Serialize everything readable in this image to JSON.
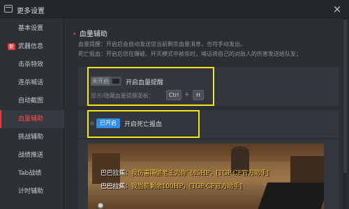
{
  "window": {
    "title": "更多设置",
    "close_icon": "×"
  },
  "sidebar": {
    "items": [
      {
        "label": "基本设置"
      },
      {
        "label": "武器信息",
        "badge": "新"
      },
      {
        "label": "击杀特效"
      },
      {
        "label": "连杀喊话"
      },
      {
        "label": "自动截图"
      },
      {
        "label": "血量辅助",
        "active": true
      },
      {
        "label": "挑战辅助"
      },
      {
        "label": "战绩推送"
      },
      {
        "label": "Tab战绩"
      },
      {
        "label": "计时辅助"
      }
    ]
  },
  "main": {
    "section_title": "血量辅助",
    "desc_hp": "血量提醒：开启后会自动发送您当前剩余血量消息，也可手动发出。",
    "desc_death": "死亡报血：开启后您在爆破、歼灭模式中被杀时，喊话将自己的对敌人的伤害发送给队友；",
    "hp_toggle": {
      "state_label": "未开启",
      "label": "开启血量提醒"
    },
    "hotkey": {
      "label": "显示/隐藏血量提醒面板：",
      "key1": "Ctrl",
      "plus": "+",
      "key2": "H"
    },
    "death_toggle": {
      "state_label": "已开启",
      "label": "开启死亡报血"
    },
    "preview_messages": [
      {
        "prefix": "巴巴拉蕉",
        "text": "：我伤害隔壁老王完你飞45HP，[TGP-CF官方助手]"
      },
      {
        "prefix": "巴巴拉蕉",
        "text": "：我当前剩余100HP，[TGP-CF官方助手]"
      }
    ]
  },
  "colors": {
    "accent_red": "#e23b3b",
    "toggle_on": "#2f8ee8",
    "highlight": "#f0e81a"
  }
}
